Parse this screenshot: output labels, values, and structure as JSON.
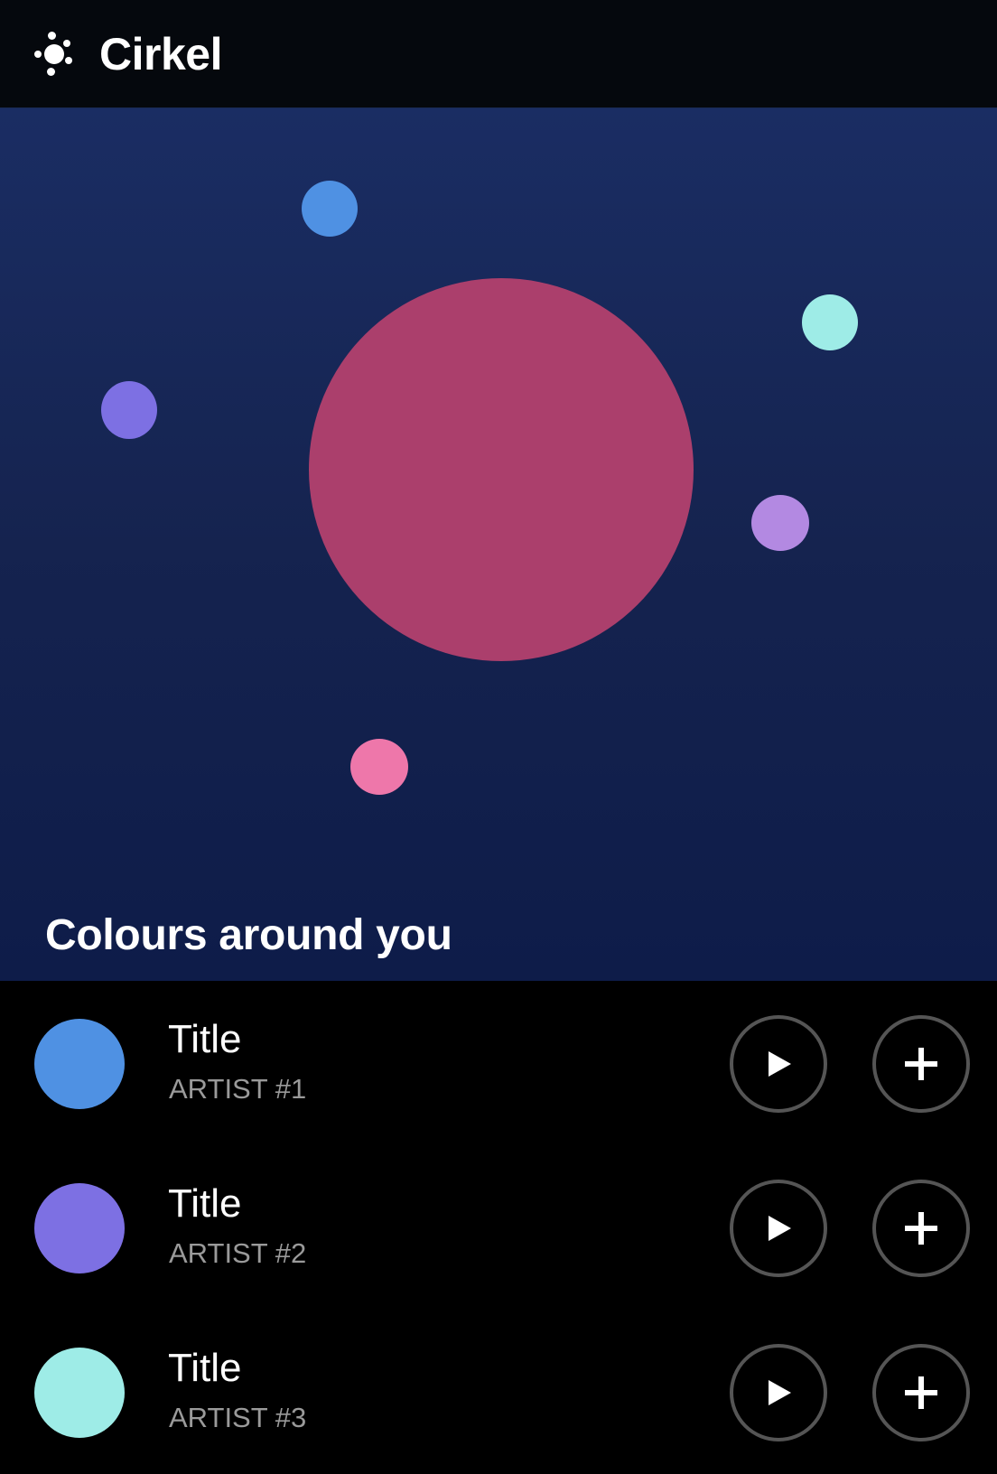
{
  "header": {
    "app_name": "Cirkel",
    "logo_icon": "cluster-dots-icon"
  },
  "hero": {
    "section_title": "Colours around you",
    "background": "#1a2d63",
    "bubbles": [
      {
        "name": "bubble-large-raspberry",
        "color": "#ab3f6c"
      },
      {
        "name": "bubble-blue",
        "color": "#4f91e3"
      },
      {
        "name": "bubble-aqua",
        "color": "#9eece7"
      },
      {
        "name": "bubble-indigo",
        "color": "#7d70e3"
      },
      {
        "name": "bubble-lavender",
        "color": "#b389e2"
      },
      {
        "name": "bubble-pink",
        "color": "#ee77aa"
      }
    ]
  },
  "tracks": [
    {
      "title": "Title",
      "artist": "ARTIST #1",
      "color": "#4f91e3",
      "play_icon": "play-icon",
      "add_icon": "plus-icon"
    },
    {
      "title": "Title",
      "artist": "ARTIST #2",
      "color": "#7d70e3",
      "play_icon": "play-icon",
      "add_icon": "plus-icon"
    },
    {
      "title": "Title",
      "artist": "ARTIST #3",
      "color": "#9eece7",
      "play_icon": "play-icon",
      "add_icon": "plus-icon"
    }
  ]
}
